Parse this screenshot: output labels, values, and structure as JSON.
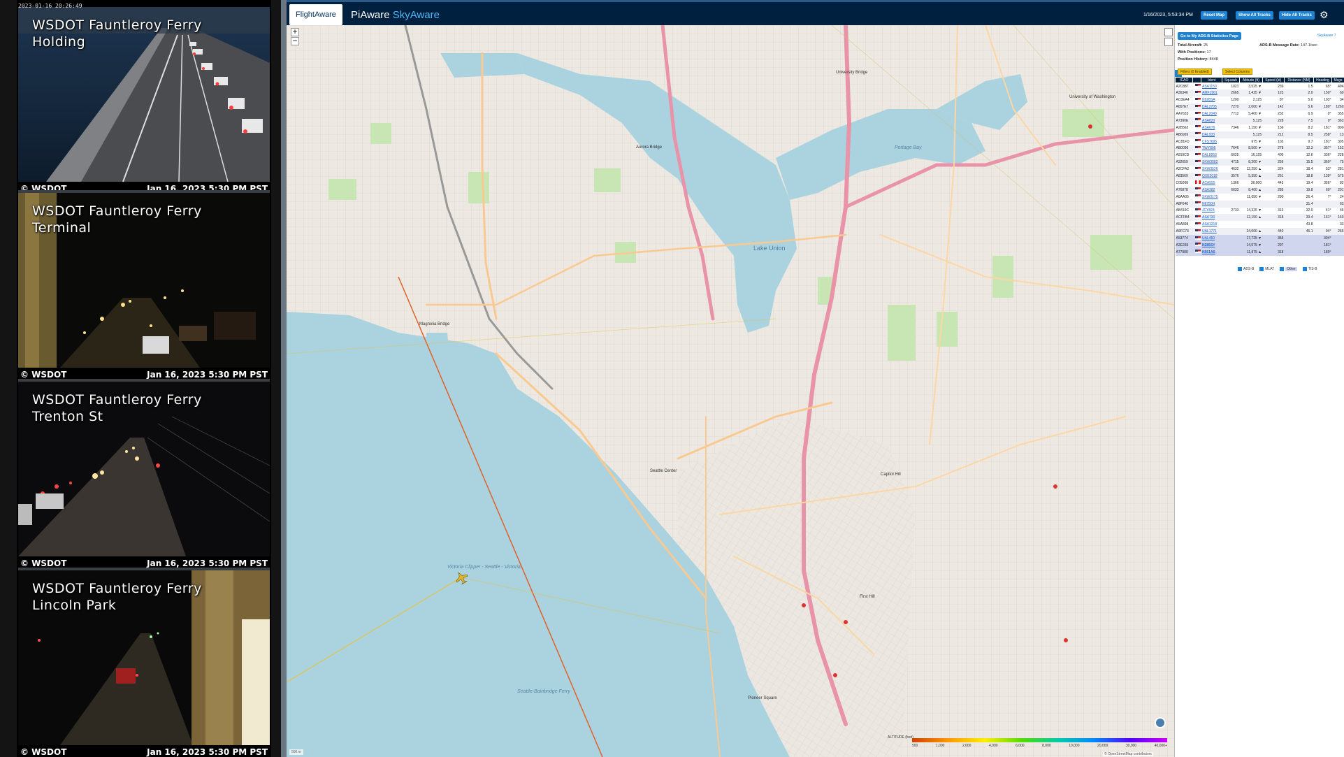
{
  "cameras": {
    "clock": "2023-01-16 20:26:49",
    "feeds": [
      {
        "title": "WSDOT Fauntleroy Ferry\nHolding",
        "credit": "© WSDOT",
        "timestamp": "Jan 16, 2023 5:30 PM PST"
      },
      {
        "title": "WSDOT Fauntleroy Ferry\nTerminal",
        "credit": "© WSDOT",
        "timestamp": "Jan 16, 2023 5:30 PM PST"
      },
      {
        "title": "WSDOT Fauntleroy Ferry\nTrenton St",
        "credit": "© WSDOT",
        "timestamp": "Jan 16, 2023 5:30 PM PST"
      },
      {
        "title": "WSDOT Fauntleroy Ferry\nLincoln Park",
        "credit": "© WSDOT",
        "timestamp": "Jan 16, 2023 5:30 PM PST"
      }
    ]
  },
  "header": {
    "logo": "FlightAware",
    "title_main": "PiAware",
    "title_accent": "SkyAware",
    "datetime": "1/16/2023, 5:53:34 PM",
    "buttons": {
      "reset_map": "Reset Map",
      "show_all_tracks": "Show All Tracks",
      "hide_all_tracks": "Hide All Tracks"
    },
    "settings_icon": "gear-icon"
  },
  "map": {
    "zoom_in": "+",
    "zoom_out": "−",
    "labels": {
      "lake_union": "Lake Union",
      "portage_bay": "Portage Bay",
      "uw": "University of Washington",
      "magnolia_bridge": "Magnolia Bridge",
      "seattle_center": "Seattle Center",
      "capitol_hill": "Capitol Hill",
      "first_hill": "First Hill",
      "university_bridge": "University Bridge",
      "aurora_bridge": "Aurora Bridge",
      "pioneer_square": "Pioneer Square",
      "ferry_route": "Victoria Clipper - Seattle - Victoria",
      "bainbridge_ferry": "Seattle-Bainbridge Ferry"
    },
    "altitude_legend": {
      "label": "ALTITUDE (feet)",
      "ticks": [
        "500",
        "1,000",
        "2,000",
        "4,000",
        "6,000",
        "8,000",
        "10,000",
        "20,000",
        "30,000",
        "40,000+"
      ]
    },
    "scale": "500 m",
    "attribution": "© OpenStreetMap contributors"
  },
  "sidebar": {
    "stats_button": "Go to My ADS-B Statistics Page",
    "skyaware_link": "SkyAware 7",
    "total_aircraft_label": "Total Aircraft:",
    "total_aircraft": "25",
    "with_positions_label": "With Positions:",
    "with_positions": "17",
    "position_history_label": "Position History:",
    "position_history": "8448",
    "msg_rate_label": "ADS-B Message Rate:",
    "msg_rate": "147.1/sec",
    "filters_button": "Filters (0 Enabled)",
    "columns_button": "Select Columns",
    "columns": [
      "ICAO",
      "",
      "Ident",
      "Squawk",
      "Altitude (ft)",
      "Speed (kt)",
      "Distance (NM)",
      "Heading",
      "Msgs"
    ],
    "rows": [
      {
        "icao": "A2C887",
        "flag": "us",
        "ident": "ASA1150",
        "squawk": "1021",
        "alt": "3,525 ▼",
        "speed": "239",
        "dist": "1.5",
        "hdg": "65°",
        "msgs": "494",
        "type": ""
      },
      {
        "icao": "A36346",
        "flag": "us",
        "ident": "AMF1961",
        "squawk": "2665",
        "alt": "1,425 ▼",
        "speed": "123",
        "dist": "2.0",
        "hdg": "150°",
        "msgs": "60",
        "type": ""
      },
      {
        "icao": "AC0EA4",
        "flag": "us",
        "ident": "N928SA",
        "squawk": "1200",
        "alt": "2,125",
        "speed": "87",
        "dist": "5.0",
        "hdg": "193°",
        "msgs": "34",
        "type": ""
      },
      {
        "icao": "A657E7",
        "flag": "us",
        "ident": "DAL2705",
        "squawk": "7270",
        "alt": "2,000 ▼",
        "speed": "142",
        "dist": "5.6",
        "hdg": "180°",
        "msgs": "1260",
        "type": ""
      },
      {
        "icao": "AA7633",
        "flag": "us",
        "ident": "DAL2040",
        "squawk": "7712",
        "alt": "5,400 ▼",
        "speed": "232",
        "dist": "6.9",
        "hdg": "0°",
        "msgs": "355",
        "type": ""
      },
      {
        "icao": "A7390E",
        "flag": "us",
        "ident": "ASA820",
        "squawk": "",
        "alt": "5,125",
        "speed": "228",
        "dist": "7.5",
        "hdg": "0°",
        "msgs": "363",
        "type": ""
      },
      {
        "icao": "A2B562",
        "flag": "us",
        "ident": "ASA676",
        "squawk": "7346",
        "alt": "1,150 ▼",
        "speed": "136",
        "dist": "8.2",
        "hdg": "181°",
        "msgs": "800",
        "type": ""
      },
      {
        "icao": "AB6926",
        "flag": "us",
        "ident": "DAL933",
        "squawk": "",
        "alt": "5,125",
        "speed": "212",
        "dist": "8.5",
        "hdg": "258°",
        "msgs": "13",
        "type": ""
      },
      {
        "icao": "AC81FD",
        "flag": "us",
        "ident": "CFS7695",
        "squawk": "",
        "alt": "675 ▼",
        "speed": "102",
        "dist": "9.7",
        "hdg": "181°",
        "msgs": "305",
        "type": ""
      },
      {
        "icao": "AB0096",
        "flag": "us",
        "ident": "TWY806",
        "squawk": "7646",
        "alt": "8,500 ▼",
        "speed": "278",
        "dist": "12.3",
        "hdg": "357°",
        "msgs": "152",
        "type": ""
      },
      {
        "icao": "A919CD",
        "flag": "us",
        "ident": "DAL8953",
        "squawk": "6625",
        "alt": "16,125",
        "speed": "400",
        "dist": "12.6",
        "hdg": "336°",
        "msgs": "228",
        "type": ""
      },
      {
        "icao": "A32659",
        "flag": "us",
        "ident": "SKW3582",
        "squawk": "4715",
        "alt": "8,200 ▼",
        "speed": "256",
        "dist": "15.5",
        "hdg": "360°",
        "msgs": "75",
        "type": ""
      },
      {
        "icao": "A2CFA2",
        "flag": "us",
        "ident": "SKW3526",
        "squawk": "4632",
        "alt": "12,250 ▲",
        "speed": "324",
        "dist": "18.4",
        "hdg": "53°",
        "msgs": "281",
        "type": ""
      },
      {
        "icao": "A83569",
        "flag": "us",
        "ident": "QXE2018",
        "squawk": "3576",
        "alt": "5,350 ▲",
        "speed": "261",
        "dist": "18.8",
        "hdg": "139°",
        "msgs": "575",
        "type": ""
      },
      {
        "icao": "C05068",
        "flag": "ca",
        "ident": "ACA555",
        "squawk": "1366",
        "alt": "36,000",
        "speed": "443",
        "dist": "19.4",
        "hdg": "356°",
        "msgs": "82",
        "type": ""
      },
      {
        "icao": "A76878",
        "flag": "us",
        "ident": "ASA382",
        "squawk": "6633",
        "alt": "8,400 ▲",
        "speed": "285",
        "dist": "19.8",
        "hdg": "69°",
        "msgs": "201",
        "type": ""
      },
      {
        "icao": "A6AA05",
        "flag": "us",
        "ident": "SKW3175",
        "squawk": "",
        "alt": "11,050 ▼",
        "speed": "290",
        "dist": "26.4",
        "hdg": "7°",
        "msgs": "24",
        "type": ""
      },
      {
        "icao": "A8F040",
        "flag": "us",
        "ident": "N6750H",
        "squawk": "",
        "alt": "",
        "speed": "",
        "dist": "31.4",
        "hdg": "",
        "msgs": "63",
        "type": ""
      },
      {
        "icao": "AB419C",
        "flag": "us",
        "ident": "JCY824",
        "squawk": "2733",
        "alt": "14,325 ▼",
        "speed": "313",
        "dist": "32.0",
        "hdg": "41°",
        "msgs": "46",
        "type": ""
      },
      {
        "icao": "ACFFB4",
        "flag": "us",
        "ident": "ASA730",
        "squawk": "",
        "alt": "12,150 ▲",
        "speed": "318",
        "dist": "33.4",
        "hdg": "161°",
        "msgs": "160",
        "type": ""
      },
      {
        "icao": "A5A898",
        "flag": "us",
        "ident": "ASA1318",
        "squawk": "",
        "alt": "",
        "speed": "",
        "dist": "43.8",
        "hdg": "",
        "msgs": "33",
        "type": ""
      },
      {
        "icao": "A9FC73",
        "flag": "us",
        "ident": "UAL1771",
        "squawk": "",
        "alt": "24,000 ▲",
        "speed": "440",
        "dist": "46.1",
        "hdg": "94°",
        "msgs": "265",
        "type": ""
      },
      {
        "icao": "A53774",
        "flag": "us",
        "ident": "UAL450",
        "squawk": "",
        "alt": "17,725 ▼",
        "speed": "355",
        "dist": "",
        "hdg": "304°",
        "msgs": "",
        "type": "mlat"
      },
      {
        "icao": "A2E235",
        "flag": "us",
        "ident": "N285SY",
        "squawk": "",
        "alt": "14,575 ▼",
        "speed": "297",
        "dist": "",
        "hdg": "181°",
        "msgs": "",
        "type": "mlat"
      },
      {
        "icao": "A77080",
        "flag": "us",
        "ident": "N561AS",
        "squawk": "",
        "alt": "11,975 ▲",
        "speed": "318",
        "dist": "",
        "hdg": "180°",
        "msgs": "",
        "type": "mlat"
      }
    ],
    "legend": [
      {
        "label": "ADS-B"
      },
      {
        "label": "MLAT"
      },
      {
        "label": "Other"
      },
      {
        "label": "TIS-B"
      }
    ]
  },
  "colors": {
    "nav_bg": "#00203f",
    "accent": "#1f82d0",
    "water": "#aad3df",
    "track_orange": "#e0622a",
    "track_yellow": "#e0c34a"
  }
}
